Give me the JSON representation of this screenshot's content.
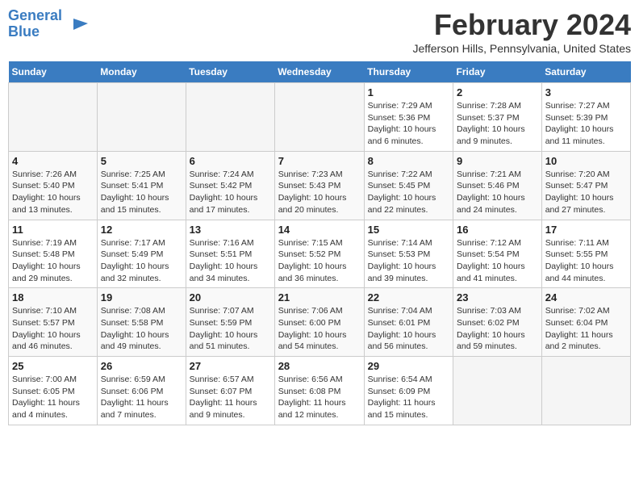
{
  "logo": {
    "line1": "General",
    "line2": "Blue"
  },
  "title": "February 2024",
  "location": "Jefferson Hills, Pennsylvania, United States",
  "days_of_week": [
    "Sunday",
    "Monday",
    "Tuesday",
    "Wednesday",
    "Thursday",
    "Friday",
    "Saturday"
  ],
  "weeks": [
    [
      {
        "num": "",
        "info": ""
      },
      {
        "num": "",
        "info": ""
      },
      {
        "num": "",
        "info": ""
      },
      {
        "num": "",
        "info": ""
      },
      {
        "num": "1",
        "info": "Sunrise: 7:29 AM\nSunset: 5:36 PM\nDaylight: 10 hours\nand 6 minutes."
      },
      {
        "num": "2",
        "info": "Sunrise: 7:28 AM\nSunset: 5:37 PM\nDaylight: 10 hours\nand 9 minutes."
      },
      {
        "num": "3",
        "info": "Sunrise: 7:27 AM\nSunset: 5:39 PM\nDaylight: 10 hours\nand 11 minutes."
      }
    ],
    [
      {
        "num": "4",
        "info": "Sunrise: 7:26 AM\nSunset: 5:40 PM\nDaylight: 10 hours\nand 13 minutes."
      },
      {
        "num": "5",
        "info": "Sunrise: 7:25 AM\nSunset: 5:41 PM\nDaylight: 10 hours\nand 15 minutes."
      },
      {
        "num": "6",
        "info": "Sunrise: 7:24 AM\nSunset: 5:42 PM\nDaylight: 10 hours\nand 17 minutes."
      },
      {
        "num": "7",
        "info": "Sunrise: 7:23 AM\nSunset: 5:43 PM\nDaylight: 10 hours\nand 20 minutes."
      },
      {
        "num": "8",
        "info": "Sunrise: 7:22 AM\nSunset: 5:45 PM\nDaylight: 10 hours\nand 22 minutes."
      },
      {
        "num": "9",
        "info": "Sunrise: 7:21 AM\nSunset: 5:46 PM\nDaylight: 10 hours\nand 24 minutes."
      },
      {
        "num": "10",
        "info": "Sunrise: 7:20 AM\nSunset: 5:47 PM\nDaylight: 10 hours\nand 27 minutes."
      }
    ],
    [
      {
        "num": "11",
        "info": "Sunrise: 7:19 AM\nSunset: 5:48 PM\nDaylight: 10 hours\nand 29 minutes."
      },
      {
        "num": "12",
        "info": "Sunrise: 7:17 AM\nSunset: 5:49 PM\nDaylight: 10 hours\nand 32 minutes."
      },
      {
        "num": "13",
        "info": "Sunrise: 7:16 AM\nSunset: 5:51 PM\nDaylight: 10 hours\nand 34 minutes."
      },
      {
        "num": "14",
        "info": "Sunrise: 7:15 AM\nSunset: 5:52 PM\nDaylight: 10 hours\nand 36 minutes."
      },
      {
        "num": "15",
        "info": "Sunrise: 7:14 AM\nSunset: 5:53 PM\nDaylight: 10 hours\nand 39 minutes."
      },
      {
        "num": "16",
        "info": "Sunrise: 7:12 AM\nSunset: 5:54 PM\nDaylight: 10 hours\nand 41 minutes."
      },
      {
        "num": "17",
        "info": "Sunrise: 7:11 AM\nSunset: 5:55 PM\nDaylight: 10 hours\nand 44 minutes."
      }
    ],
    [
      {
        "num": "18",
        "info": "Sunrise: 7:10 AM\nSunset: 5:57 PM\nDaylight: 10 hours\nand 46 minutes."
      },
      {
        "num": "19",
        "info": "Sunrise: 7:08 AM\nSunset: 5:58 PM\nDaylight: 10 hours\nand 49 minutes."
      },
      {
        "num": "20",
        "info": "Sunrise: 7:07 AM\nSunset: 5:59 PM\nDaylight: 10 hours\nand 51 minutes."
      },
      {
        "num": "21",
        "info": "Sunrise: 7:06 AM\nSunset: 6:00 PM\nDaylight: 10 hours\nand 54 minutes."
      },
      {
        "num": "22",
        "info": "Sunrise: 7:04 AM\nSunset: 6:01 PM\nDaylight: 10 hours\nand 56 minutes."
      },
      {
        "num": "23",
        "info": "Sunrise: 7:03 AM\nSunset: 6:02 PM\nDaylight: 10 hours\nand 59 minutes."
      },
      {
        "num": "24",
        "info": "Sunrise: 7:02 AM\nSunset: 6:04 PM\nDaylight: 11 hours\nand 2 minutes."
      }
    ],
    [
      {
        "num": "25",
        "info": "Sunrise: 7:00 AM\nSunset: 6:05 PM\nDaylight: 11 hours\nand 4 minutes."
      },
      {
        "num": "26",
        "info": "Sunrise: 6:59 AM\nSunset: 6:06 PM\nDaylight: 11 hours\nand 7 minutes."
      },
      {
        "num": "27",
        "info": "Sunrise: 6:57 AM\nSunset: 6:07 PM\nDaylight: 11 hours\nand 9 minutes."
      },
      {
        "num": "28",
        "info": "Sunrise: 6:56 AM\nSunset: 6:08 PM\nDaylight: 11 hours\nand 12 minutes."
      },
      {
        "num": "29",
        "info": "Sunrise: 6:54 AM\nSunset: 6:09 PM\nDaylight: 11 hours\nand 15 minutes."
      },
      {
        "num": "",
        "info": ""
      },
      {
        "num": "",
        "info": ""
      }
    ]
  ]
}
